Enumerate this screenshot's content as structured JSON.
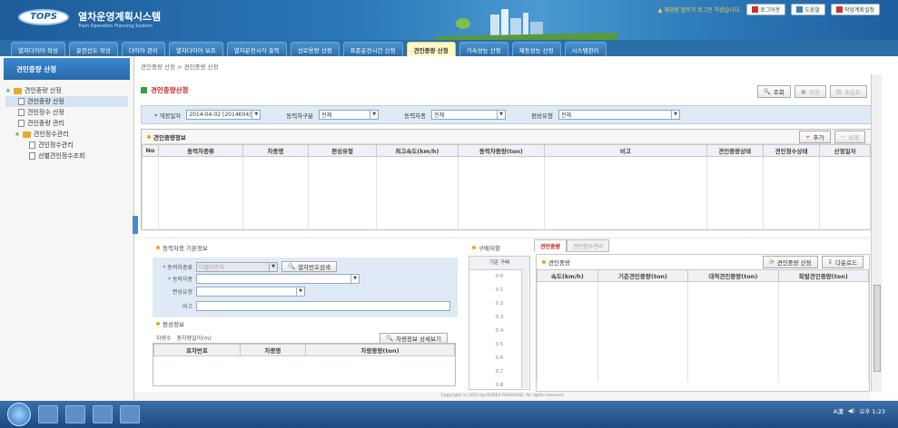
{
  "app": {
    "logo": "TOPS",
    "title": "열차운영계획시스템",
    "subtitle": "Train Operation Planning System"
  },
  "header": {
    "notice": "▲ 해당된 업무가 로그인 하셨습니다.",
    "logout": "로그아웃",
    "help": "도움말",
    "settings": "작업계획설정"
  },
  "menu": [
    "열차다이아 작성",
    "운전선도 작성",
    "다이아 관리",
    "열차다이아 보조",
    "열차운전시각 출력",
    "선로용량 산정",
    "표준운전시간 산정",
    "견인중량 산정",
    "가속성능 산정",
    "제동성능 산정",
    "시스템관리"
  ],
  "sidebar": {
    "title": "견인중량 산정",
    "items": [
      {
        "label": "견인중량 산정",
        "type": "folder"
      },
      {
        "label": "견인중량 산정",
        "type": "doc",
        "selected": true
      },
      {
        "label": "견인정수 산정",
        "type": "doc"
      },
      {
        "label": "견인중량 관리",
        "type": "doc"
      },
      {
        "label": "견인정수관리",
        "type": "folder"
      },
      {
        "label": "견인정수관리",
        "type": "doc"
      },
      {
        "label": "선별견인정수조회",
        "type": "doc"
      }
    ]
  },
  "breadcrumb": "견인중량 산정 > 견인중량 산정",
  "page": {
    "title": "견인중량산정",
    "btn_search": "조회",
    "btn_save": "저장",
    "btn_print": "프린트"
  },
  "cond": {
    "date_label": "* 개정일자",
    "date_value": "2014-04-02 [2014K04]",
    "type_label": "동력차구분",
    "type_value": "전체",
    "car_label": "동력차종",
    "car_value": "전체",
    "form_label": "편성유형",
    "form_value": "전체"
  },
  "grid1": {
    "title": "견인중량정보",
    "add": "추가",
    "del": "삭제",
    "cols": [
      "No",
      "동력차종류",
      "차종명",
      "편성유형",
      "최고속도(km/h)",
      "동력차중량(ton)",
      "비고",
      "견인중량상태",
      "견인정수상태",
      "산정일자"
    ]
  },
  "basic": {
    "title": "동력차종 기본정보",
    "f1": "* 동력차종류",
    "f1v": "디젤기관차",
    "f2": "* 동력차종",
    "f3": "편성유형",
    "f4": "비고",
    "btn_car": "열차번호검색",
    "form_title": "편성정보",
    "cars_label": "차량수",
    "weight_label": "총차량길이(m)",
    "btn_detail": "차량정보 상세보기",
    "cols": [
      "호차번호",
      "차종명",
      "차량중량(ton)"
    ]
  },
  "gradient": {
    "title": "구배저항",
    "col": "기준 구배",
    "rows": [
      "0.0",
      "0.1",
      "0.2",
      "0.3",
      "0.4",
      "0.5",
      "0.6",
      "0.7",
      "0.8"
    ]
  },
  "tabs2": {
    "t1": "견인중량",
    "t2": "견인정수관리",
    "title": "견인중량",
    "btn_calc": "견인중량 산정",
    "btn_dl": "다운로드",
    "cols": [
      "속도(km/h)",
      "기준견인중량(ton)",
      "대적견인중량(ton)",
      "회발견인중량(ton)"
    ]
  },
  "footer": "Copyright (c) 2012 by KOREA RAILROAD. All rights reserved.",
  "tray": {
    "time": "오후 1:23"
  }
}
